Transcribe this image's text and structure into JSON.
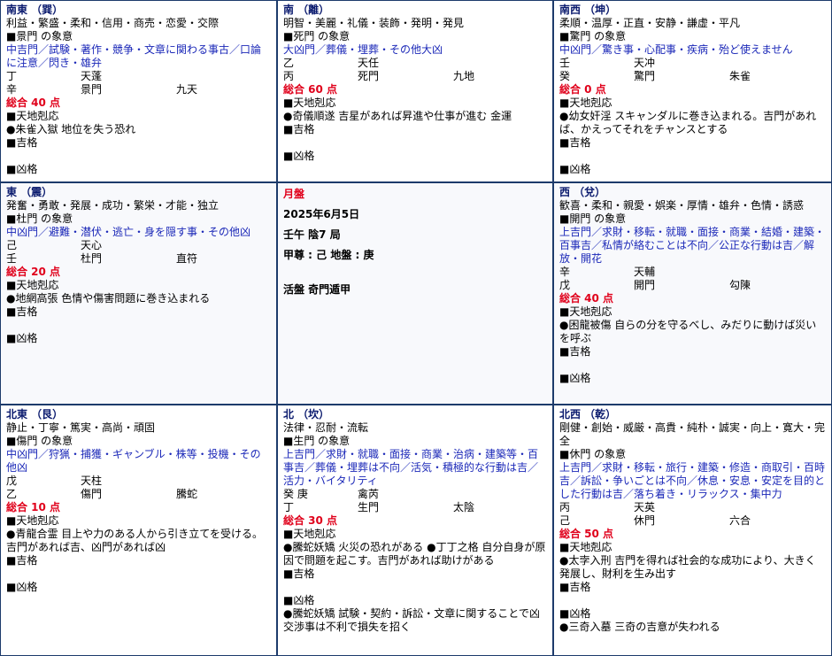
{
  "center": {
    "title": "月盤",
    "date": "2025年6月5日",
    "ganzhi": "壬午 陰7 局",
    "zun": "甲尊 : 己 地盤 : 庚",
    "method": "活盤 奇門遁甲"
  },
  "cells": {
    "se": {
      "title": "南東 （巽）",
      "traits": "利益・繁盛・柔和・信用・商売・恋愛・交際",
      "gate": "■景門 の象意",
      "gate_desc": "中吉門／試験・著作・競争・文章に関わる事古／口論に注意／閃き・雄弁",
      "r1": [
        "丁",
        "天蓬",
        ""
      ],
      "r2": [
        "辛",
        "景門",
        "九天"
      ],
      "score": "総合 40 点",
      "tenchi": "■天地剋応",
      "tenchi_desc": "●朱雀入獄 地位を失う恐れ",
      "kichi": "■吉格",
      "kichi_desc": "",
      "kyo": "■凶格",
      "kyo_desc": ""
    },
    "s": {
      "title": "南 （離）",
      "traits": "明智・美麗・礼儀・装飾・発明・発見",
      "gate": "■死門 の象意",
      "gate_desc": "大凶門／葬儀・埋葬・その他大凶",
      "r1": [
        "乙",
        "天任",
        ""
      ],
      "r2": [
        "丙",
        "死門",
        "九地"
      ],
      "score": "総合 60 点",
      "tenchi": "■天地剋応",
      "tenchi_desc": "●奇儀順遂 吉星があれば昇進や仕事が進む 金運",
      "kichi": "■吉格",
      "kichi_desc": "",
      "kyo": "■凶格",
      "kyo_desc": ""
    },
    "sw": {
      "title": "南西 （坤）",
      "traits": "柔順・温厚・正直・安静・謙虚・平凡",
      "gate": "■驚門 の象意",
      "gate_desc": "中凶門／驚き事・心配事・疾病・殆ど使えません",
      "r1": [
        "壬",
        "天冲",
        ""
      ],
      "r2": [
        "癸",
        "驚門",
        "朱雀"
      ],
      "score": "総合 0 点",
      "tenchi": "■天地剋応",
      "tenchi_desc": "●幼女奸淫 スキャンダルに巻き込まれる。吉門があれば、かえってそれをチャンスとする",
      "kichi": "■吉格",
      "kichi_desc": "",
      "kyo": "■凶格",
      "kyo_desc": ""
    },
    "e": {
      "title": "東 （震）",
      "traits": "発奮・勇敢・発展・成功・繁栄・才能・独立",
      "gate": "■杜門 の象意",
      "gate_desc": "中凶門／避難・潜伏・逃亡・身を隠す事・その他凶",
      "r1": [
        "己",
        "天心",
        ""
      ],
      "r2": [
        "壬",
        "杜門",
        "直符"
      ],
      "score": "総合 20 点",
      "tenchi": "■天地剋応",
      "tenchi_desc": "●地網高張 色情や傷害問題に巻き込まれる",
      "kichi": "■吉格",
      "kichi_desc": "",
      "kyo": "■凶格",
      "kyo_desc": ""
    },
    "w": {
      "title": "西 （兌）",
      "traits": "歓喜・柔和・親愛・娯楽・厚情・雄弁・色情・誘惑",
      "gate": "■開門 の象意",
      "gate_desc": "上吉門／求財・移転・就職・面接・商業・結婚・建築・百事吉／私情が絡むことは不向／公正な行動は吉／解放・開花",
      "r1": [
        "辛",
        "天輔",
        ""
      ],
      "r2": [
        "戊",
        "開門",
        "勾陳"
      ],
      "score": "総合 40 点",
      "tenchi": "■天地剋応",
      "tenchi_desc": "●困龍被傷 自らの分を守るべし、みだりに動けば災いを呼ぶ",
      "kichi": "■吉格",
      "kichi_desc": "",
      "kyo": "■凶格",
      "kyo_desc": ""
    },
    "ne": {
      "title": "北東 （艮）",
      "traits": "静止・丁寧・篤実・高尚・頑固",
      "gate": "■傷門 の象意",
      "gate_desc": "中凶門／狩猟・捕獲・ギャンブル・株等・投機・その他凶",
      "r1": [
        "戊",
        "天柱",
        ""
      ],
      "r2": [
        "乙",
        "傷門",
        "騰蛇"
      ],
      "score": "総合 10 点",
      "tenchi": "■天地剋応",
      "tenchi_desc": "●青龍合霊 目上や力のある人から引き立てを受ける。吉門があれば吉、凶門があれば凶",
      "kichi": "■吉格",
      "kichi_desc": "",
      "kyo": "■凶格",
      "kyo_desc": ""
    },
    "n": {
      "title": "北 （坎）",
      "traits": "法律・忍耐・流転",
      "gate": "■生門 の象意",
      "gate_desc": "上吉門／求財・就職・面接・商業・治病・建築等・百事吉／葬儀・埋葬は不向／活気・積極的な行動は吉／活力・バイタリティ",
      "r1": [
        "癸 庚",
        "禽芮",
        ""
      ],
      "r2": [
        "丁",
        "生門",
        "太陰"
      ],
      "score": "総合 30 点",
      "tenchi": "■天地剋応",
      "tenchi_desc": "●騰蛇妖矯 火災の恐れがある ●丁丁之格 自分自身が原因で問題を起こす。吉門があれば助けがある",
      "kichi": "■吉格",
      "kichi_desc": "",
      "kyo": "■凶格",
      "kyo_desc": "●騰蛇妖矯 試験・契約・訴訟・文章に関することで凶 交渉事は不利で損失を招く"
    },
    "nw": {
      "title": "北西 （乾）",
      "traits": "剛健・創始・威厳・高貴・純朴・誠実・向上・寛大・完全",
      "gate": "■休門 の象意",
      "gate_desc": "上吉門／求財・移転・旅行・建築・修造・商取引・百時吉／訴訟・争いごとは不向／休息・安息・安定を目的とした行動は吉／落ち着き・リラックス・集中力",
      "r1": [
        "丙",
        "天英",
        ""
      ],
      "r2": [
        "己",
        "休門",
        "六合"
      ],
      "score": "総合 50 点",
      "tenchi": "■天地剋応",
      "tenchi_desc": "●太孛入刑 吉門を得れば社会的な成功により、大きく発展し、財利を生み出す",
      "kichi": "■吉格",
      "kichi_desc": "",
      "kyo": "■凶格",
      "kyo_desc": "●三奇入墓 三奇の吉意が失われる"
    }
  }
}
